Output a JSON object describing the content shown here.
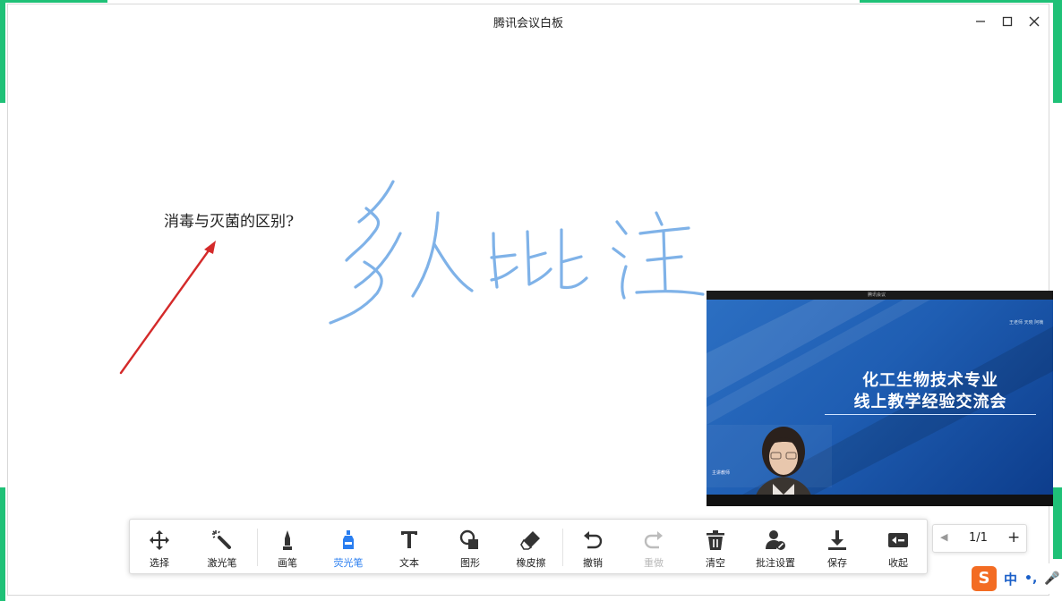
{
  "window": {
    "title": "腾讯会议白板"
  },
  "canvas": {
    "question_text": "消毒与灭菌的区别?",
    "handwriting": "多人批注"
  },
  "video": {
    "slide_line1": "化工生物技术专业",
    "slide_line2": "线上教学经验交流会",
    "top_text": "腾讯会议",
    "right_text": "王老师 天晓 阿楠",
    "left_text": "主讲教师"
  },
  "toolbar": {
    "tools": [
      {
        "label": "选择",
        "icon": "move-icon"
      },
      {
        "label": "激光笔",
        "icon": "laser-wand-icon"
      },
      {
        "label": "画笔",
        "icon": "marker-pen-icon"
      },
      {
        "label": "荧光笔",
        "icon": "highlighter-icon"
      },
      {
        "label": "文本",
        "icon": "text-t-icon"
      },
      {
        "label": "图形",
        "icon": "shapes-icon"
      },
      {
        "label": "橡皮擦",
        "icon": "eraser-icon"
      },
      {
        "label": "撤销",
        "icon": "undo-icon"
      },
      {
        "label": "重做",
        "icon": "redo-icon"
      },
      {
        "label": "清空",
        "icon": "trash-icon"
      },
      {
        "label": "批注设置",
        "icon": "user-settings-icon"
      },
      {
        "label": "保存",
        "icon": "download-icon"
      },
      {
        "label": "收起",
        "icon": "collapse-icon"
      }
    ],
    "active_tool": "荧光笔",
    "disabled_tool": "重做"
  },
  "pager": {
    "text": "1/1",
    "prev": "◀",
    "next": "+"
  },
  "ime": {
    "logo": "S",
    "mode": "中",
    "punct": "•,",
    "mic": "🎤"
  },
  "colors": {
    "accent": "#2a7ef0",
    "green": "#1fc177",
    "arrow": "#d42a2a",
    "highlighter": "#7fb2e8"
  }
}
